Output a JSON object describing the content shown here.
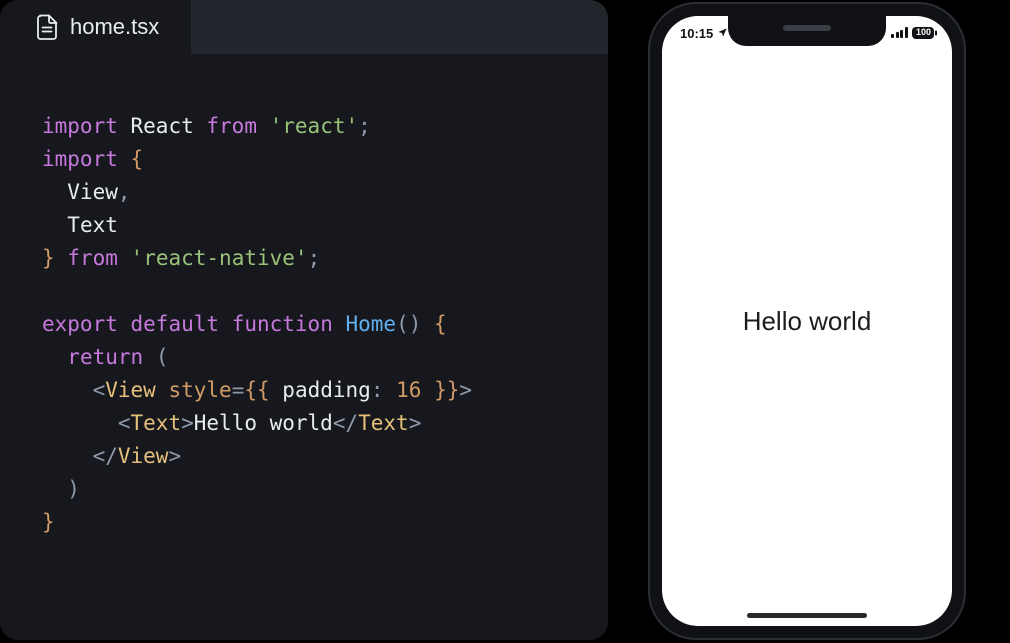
{
  "editor": {
    "filename": "home.tsx",
    "code": {
      "line1": {
        "import": "import",
        "ident": "React",
        "from": "from",
        "mod": "'react'",
        "semi": ";"
      },
      "line2": {
        "import": "import",
        "brace": "{"
      },
      "line3": {
        "ident": "View",
        "comma": ","
      },
      "line4": {
        "ident": "Text"
      },
      "line5": {
        "brace": "}",
        "from": "from",
        "mod": "'react-native'",
        "semi": ";"
      },
      "line7": {
        "export": "export",
        "default": "default",
        "function": "function",
        "fname": "Home",
        "paren": "()",
        "space": " ",
        "brace": "{"
      },
      "line8": {
        "return": "return",
        "paren": "("
      },
      "line9": {
        "lt": "<",
        "tag": "View",
        "sp": " ",
        "attr": "style",
        "eq": "=",
        "bb_open": "{{",
        "sp2": " ",
        "prop": "padding",
        "colon": ":",
        "sp3": " ",
        "val": "16",
        "sp4": " ",
        "bb_close": "}}",
        "gt": ">"
      },
      "line10": {
        "open_lt": "<",
        "open_tag": "Text",
        "open_gt": ">",
        "text": "Hello world",
        "close_lt": "</",
        "close_tag": "Text",
        "close_gt": ">"
      },
      "line11": {
        "lt": "</",
        "tag": "View",
        "gt": ">"
      },
      "line12": {
        "paren": ")"
      },
      "line13": {
        "brace": "}"
      }
    }
  },
  "phone": {
    "status": {
      "time": "10:15",
      "battery": "100"
    },
    "app_text": "Hello world"
  }
}
